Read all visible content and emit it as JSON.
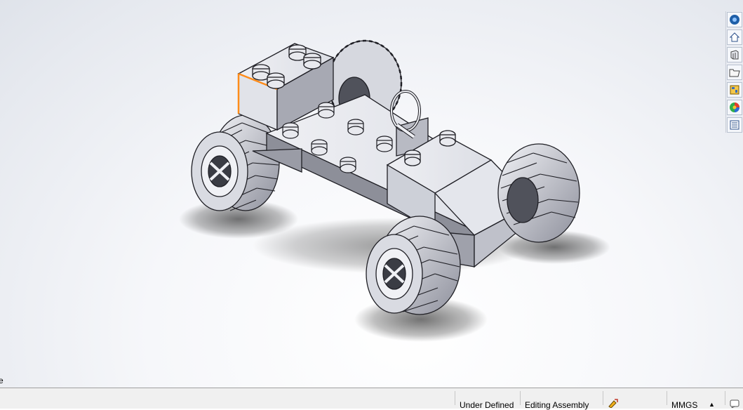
{
  "graphics_area": {
    "model": "lego-car-assembly",
    "left_edge_fragment": "e"
  },
  "task_pane": {
    "buttons": [
      {
        "name": "solidworks-resources-icon"
      },
      {
        "name": "home-icon"
      },
      {
        "name": "design-library-icon"
      },
      {
        "name": "file-explorer-icon"
      },
      {
        "name": "view-palette-icon"
      },
      {
        "name": "appearances-icon"
      },
      {
        "name": "custom-properties-icon"
      }
    ]
  },
  "status_bar": {
    "definition_status": "Under Defined",
    "mode": "Editing Assembly",
    "units": "MMGS",
    "units_arrow": "▲"
  },
  "colors": {
    "part_fill": "#e5e6ec",
    "part_shadow": "#6c6e78",
    "edge": "#1e1e24",
    "selected_edge": "#ff8c1a",
    "status_bar_bg": "#f0f0f0"
  }
}
